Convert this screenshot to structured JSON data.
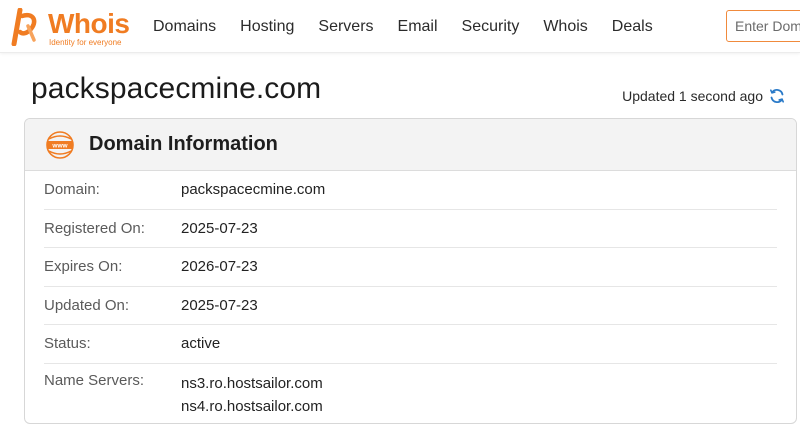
{
  "brand": {
    "name": "Whois",
    "tagline": "Identity for everyone",
    "accent": "#f07c22"
  },
  "nav": {
    "items": [
      "Domains",
      "Hosting",
      "Servers",
      "Email",
      "Security",
      "Whois",
      "Deals"
    ]
  },
  "search": {
    "placeholder": "Enter Domain or IP"
  },
  "page": {
    "title": "packspacecmine.com",
    "updated_text": "Updated 1 second ago"
  },
  "card": {
    "title": "Domain Information",
    "rows": [
      {
        "label": "Domain:",
        "value": "packspacecmine.com"
      },
      {
        "label": "Registered On:",
        "value": "2025-07-23"
      },
      {
        "label": "Expires On:",
        "value": "2026-07-23"
      },
      {
        "label": "Updated On:",
        "value": "2025-07-23"
      },
      {
        "label": "Status:",
        "value": "active"
      },
      {
        "label": "Name Servers:",
        "values": [
          "ns3.ro.hostsailor.com",
          "ns4.ro.hostsailor.com"
        ]
      }
    ]
  },
  "icons": {
    "logo": "whois-logo-icon",
    "refresh": "refresh-icon",
    "www": "www-globe-icon"
  }
}
